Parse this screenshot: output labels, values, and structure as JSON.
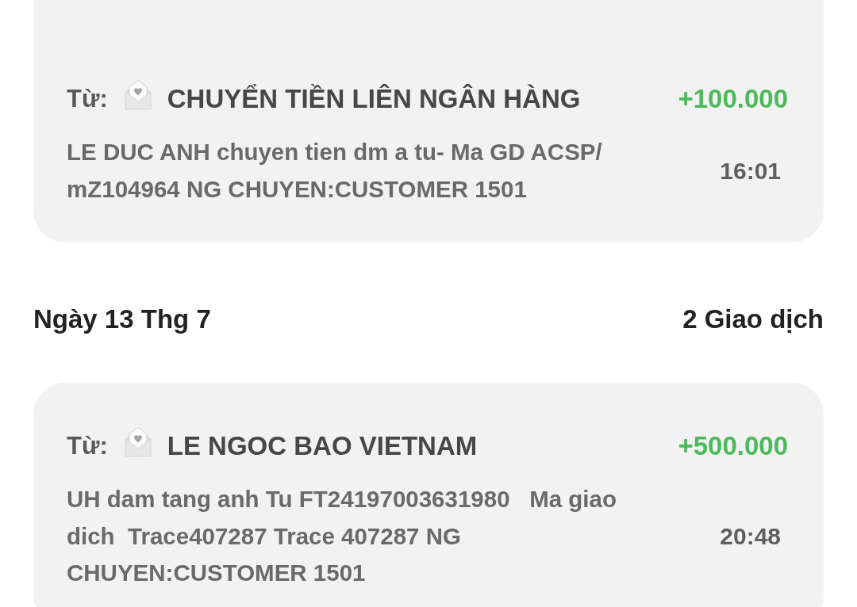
{
  "sections": [
    {
      "transactions": [
        {
          "from_label": "Từ:",
          "sender": "CHUYỂN TIỀN LIÊN NGÂN HÀNG",
          "amount": "+100.000",
          "description": "LE DUC ANH chuyen tien dm a tu- Ma GD ACSP/ mZ104964 NG CHUYEN:CUSTOMER 1501",
          "time": "16:01"
        }
      ]
    },
    {
      "date": "Ngày 13 Thg 7",
      "count": "2 Giao dịch",
      "transactions": [
        {
          "from_label": "Từ:",
          "sender": "LE NGOC BAO VIETNAM",
          "amount": "+500.000",
          "description": "UH dam tang anh Tu FT24197003631980   Ma giao dich  Trace407287 Trace 407287 NG CHUYEN:CUSTOMER 1501",
          "time": "20:48"
        }
      ]
    }
  ]
}
